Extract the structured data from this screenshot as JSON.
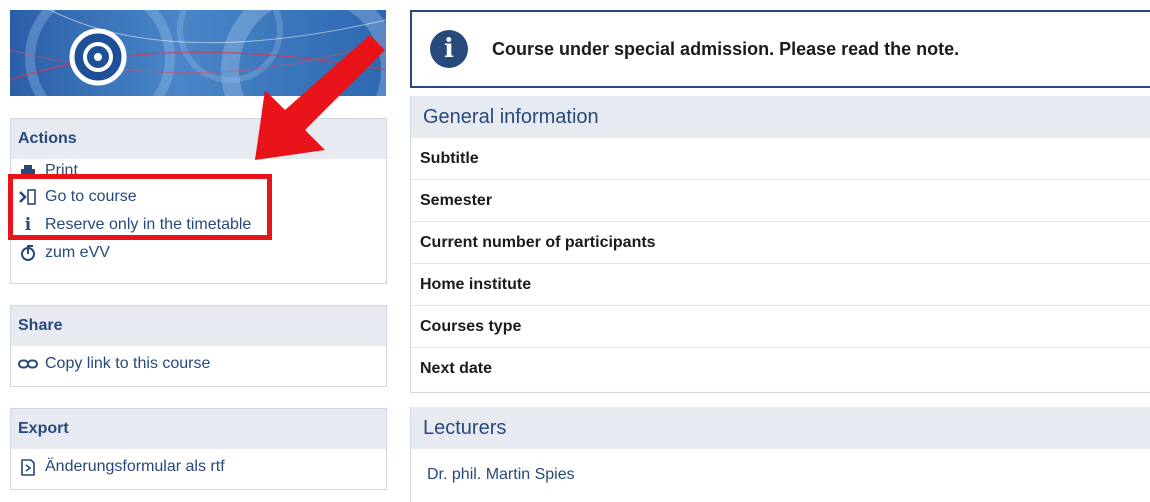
{
  "colors": {
    "accent": "#28497c",
    "header_bg": "#e7ebf1",
    "highlight": "#e8141a"
  },
  "banner": {
    "logo": "circle-logo"
  },
  "actions": {
    "title": "Actions",
    "items": [
      {
        "label": "Print",
        "icon": "print-icon"
      },
      {
        "label": "Go to course",
        "icon": "enter-icon"
      },
      {
        "label": "Reserve only in the timetable",
        "icon": "info-icon"
      },
      {
        "label": "zum eVV",
        "icon": "evv-icon"
      }
    ]
  },
  "share": {
    "title": "Share",
    "items": [
      {
        "label": "Copy link to this course",
        "icon": "link-icon"
      }
    ]
  },
  "export": {
    "title": "Export",
    "items": [
      {
        "label": "Änderungsformular als rtf",
        "icon": "document-icon"
      }
    ]
  },
  "notice": {
    "text": "Course under special admission. Please read the note.",
    "icon": "info-circle-icon"
  },
  "general": {
    "title": "General information",
    "rows": [
      "Subtitle",
      "Semester",
      "Current number of participants",
      "Home institute",
      "Courses type",
      "Next date"
    ]
  },
  "lecturers": {
    "title": "Lecturers",
    "names": [
      "Dr. phil. Martin Spies"
    ]
  }
}
